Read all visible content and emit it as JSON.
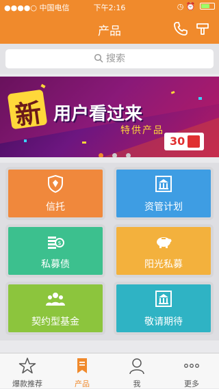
{
  "status_bar": {
    "carrier": "中国电信",
    "time": "下午2:16"
  },
  "header": {
    "title": "产品"
  },
  "search": {
    "placeholder": "搜索"
  },
  "banner": {
    "headline_char": "新",
    "headline": "用户看过来",
    "subtitle": "特供产品",
    "price_tag": "30"
  },
  "tiles": [
    {
      "label": "信托",
      "color": "#f0883c",
      "icon": "shield-icon"
    },
    {
      "label": "资管计划",
      "color": "#3e9de3",
      "icon": "building-icon"
    },
    {
      "label": "私募债",
      "color": "#3cc08e",
      "icon": "coins-icon"
    },
    {
      "label": "阳光私募",
      "color": "#f3b13d",
      "icon": "piggy-bank-icon"
    },
    {
      "label": "契约型基金",
      "color": "#8cc53d",
      "icon": "people-icon"
    },
    {
      "label": "敬请期待",
      "color": "#2fb3c4",
      "icon": "building-icon"
    }
  ],
  "tab_bar": {
    "items": [
      {
        "label": "爆款推荐",
        "icon": "star-icon"
      },
      {
        "label": "产品",
        "icon": "bookmark-icon"
      },
      {
        "label": "我",
        "icon": "person-icon"
      },
      {
        "label": "更多",
        "icon": "more-icon"
      }
    ],
    "active": "产品"
  },
  "colors": {
    "accent": "#f08a2c"
  }
}
